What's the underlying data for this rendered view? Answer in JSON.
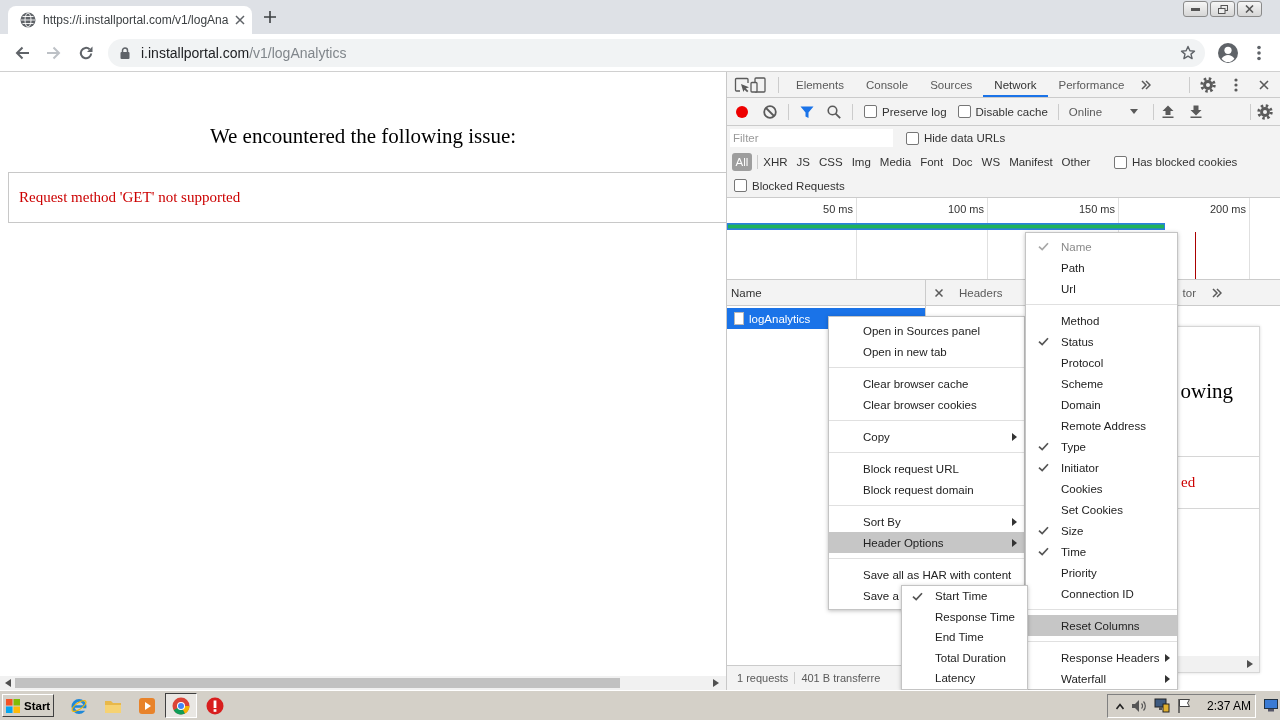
{
  "browser": {
    "tab": {
      "title": "https://i.installportal.com/v1/logAna"
    },
    "navigation": {
      "back_disabled": false,
      "forward_disabled": true
    },
    "address": {
      "host": "i.installportal.com",
      "path": "/v1/logAnalytics"
    }
  },
  "page": {
    "heading": "We encountered the following issue:",
    "message": "Request method 'GET' not supported"
  },
  "devtools": {
    "tabs": [
      {
        "label": "Elements",
        "selected": false
      },
      {
        "label": "Console",
        "selected": false
      },
      {
        "label": "Sources",
        "selected": false
      },
      {
        "label": "Network",
        "selected": true
      },
      {
        "label": "Performance",
        "selected": false
      }
    ],
    "toolbar": {
      "recording": true,
      "checkboxes": [
        {
          "label": "Preserve log",
          "checked": false
        },
        {
          "label": "Disable cache",
          "checked": false
        }
      ],
      "throttling": "Online"
    },
    "filter": {
      "placeholder": "Filter",
      "options": [
        {
          "label": "Hide data URLs",
          "checked": false
        }
      ]
    },
    "types": [
      {
        "label": "All",
        "selected": true
      },
      {
        "label": "XHR",
        "selected": false
      },
      {
        "label": "JS",
        "selected": false
      },
      {
        "label": "CSS",
        "selected": false
      },
      {
        "label": "Img",
        "selected": false
      },
      {
        "label": "Media",
        "selected": false
      },
      {
        "label": "Font",
        "selected": false
      },
      {
        "label": "Doc",
        "selected": false
      },
      {
        "label": "WS",
        "selected": false
      },
      {
        "label": "Manifest",
        "selected": false
      },
      {
        "label": "Other",
        "selected": false
      }
    ],
    "type_options": [
      {
        "label": "Has blocked cookies",
        "checked": false
      }
    ],
    "blocked_requests": {
      "label": "Blocked Requests",
      "checked": false
    },
    "overview": {
      "ticks": [
        "50 ms",
        "100 ms",
        "150 ms",
        "200 ms"
      ]
    },
    "requests": {
      "column": "Name",
      "rows": [
        {
          "name": "logAnalytics",
          "selected": true
        }
      ],
      "summary": [
        "1 requests",
        "401 B transferre"
      ]
    },
    "detail": {
      "tabs": [
        {
          "label": "Headers",
          "selected": false
        },
        {
          "label": "tor",
          "selected": false
        }
      ],
      "preview": {
        "heading": "owing",
        "message": "ed"
      }
    }
  },
  "context_menu": {
    "items": [
      {
        "kind": "item",
        "label": "Open in Sources panel",
        "selected": false
      },
      {
        "kind": "item",
        "label": "Open in new tab",
        "selected": false
      },
      {
        "kind": "separator"
      },
      {
        "kind": "item",
        "label": "Clear browser cache",
        "selected": false
      },
      {
        "kind": "item",
        "label": "Clear browser cookies",
        "selected": false
      },
      {
        "kind": "separator"
      },
      {
        "kind": "submenu",
        "label": "Copy",
        "selected": false
      },
      {
        "kind": "separator"
      },
      {
        "kind": "item",
        "label": "Block request URL",
        "selected": false
      },
      {
        "kind": "item",
        "label": "Block request domain",
        "selected": false
      },
      {
        "kind": "separator"
      },
      {
        "kind": "submenu",
        "label": "Sort By",
        "selected": false
      },
      {
        "kind": "submenu",
        "label": "Header Options",
        "selected": true
      },
      {
        "kind": "separator"
      },
      {
        "kind": "item",
        "label": "Save all as HAR with content",
        "selected": false
      },
      {
        "kind": "item",
        "label": "Save a",
        "selected": false
      }
    ]
  },
  "header_menu": {
    "items": [
      {
        "kind": "check",
        "label": "Name",
        "checked": true,
        "disabled": true,
        "selected": false
      },
      {
        "kind": "check",
        "label": "Path",
        "checked": false,
        "disabled": false,
        "selected": false
      },
      {
        "kind": "check",
        "label": "Url",
        "checked": false,
        "disabled": false,
        "selected": false
      },
      {
        "kind": "separator"
      },
      {
        "kind": "check",
        "label": "Method",
        "checked": false,
        "disabled": false,
        "selected": false
      },
      {
        "kind": "check",
        "label": "Status",
        "checked": true,
        "disabled": false,
        "selected": false
      },
      {
        "kind": "check",
        "label": "Protocol",
        "checked": false,
        "disabled": false,
        "selected": false
      },
      {
        "kind": "check",
        "label": "Scheme",
        "checked": false,
        "disabled": false,
        "selected": false
      },
      {
        "kind": "check",
        "label": "Domain",
        "checked": false,
        "disabled": false,
        "selected": false
      },
      {
        "kind": "check",
        "label": "Remote Address",
        "checked": false,
        "disabled": false,
        "selected": false
      },
      {
        "kind": "check",
        "label": "Type",
        "checked": true,
        "disabled": false,
        "selected": false
      },
      {
        "kind": "check",
        "label": "Initiator",
        "checked": true,
        "disabled": false,
        "selected": false
      },
      {
        "kind": "check",
        "label": "Cookies",
        "checked": false,
        "disabled": false,
        "selected": false
      },
      {
        "kind": "check",
        "label": "Set Cookies",
        "checked": false,
        "disabled": false,
        "selected": false
      },
      {
        "kind": "check",
        "label": "Size",
        "checked": true,
        "disabled": false,
        "selected": false
      },
      {
        "kind": "check",
        "label": "Time",
        "checked": true,
        "disabled": false,
        "selected": false
      },
      {
        "kind": "check",
        "label": "Priority",
        "checked": false,
        "disabled": false,
        "selected": false
      },
      {
        "kind": "check",
        "label": "Connection ID",
        "checked": false,
        "disabled": false,
        "selected": false
      },
      {
        "kind": "separator"
      },
      {
        "kind": "item",
        "label": "Reset Columns",
        "selected": true
      },
      {
        "kind": "separator"
      },
      {
        "kind": "submenu",
        "label": "Response Headers",
        "selected": false
      },
      {
        "kind": "submenu",
        "label": "Waterfall",
        "selected": false
      }
    ]
  },
  "waterfall_menu": {
    "items": [
      {
        "kind": "check",
        "label": "Start Time",
        "checked": true,
        "disabled": false,
        "selected": false
      },
      {
        "kind": "check",
        "label": "Response Time",
        "checked": false,
        "disabled": false,
        "selected": false
      },
      {
        "kind": "check",
        "label": "End Time",
        "checked": false,
        "disabled": false,
        "selected": false
      },
      {
        "kind": "check",
        "label": "Total Duration",
        "checked": false,
        "disabled": false,
        "selected": false
      },
      {
        "kind": "check",
        "label": "Latency",
        "checked": false,
        "disabled": false,
        "selected": false
      }
    ]
  },
  "taskbar": {
    "start": "Start",
    "apps": [
      {
        "kind": "ring",
        "active": false
      },
      {
        "kind": "folder",
        "active": false
      },
      {
        "kind": "player",
        "active": false
      },
      {
        "kind": "wheel",
        "active": true
      },
      {
        "kind": "alert",
        "active": false
      }
    ],
    "clock": "2:37 AM"
  }
}
